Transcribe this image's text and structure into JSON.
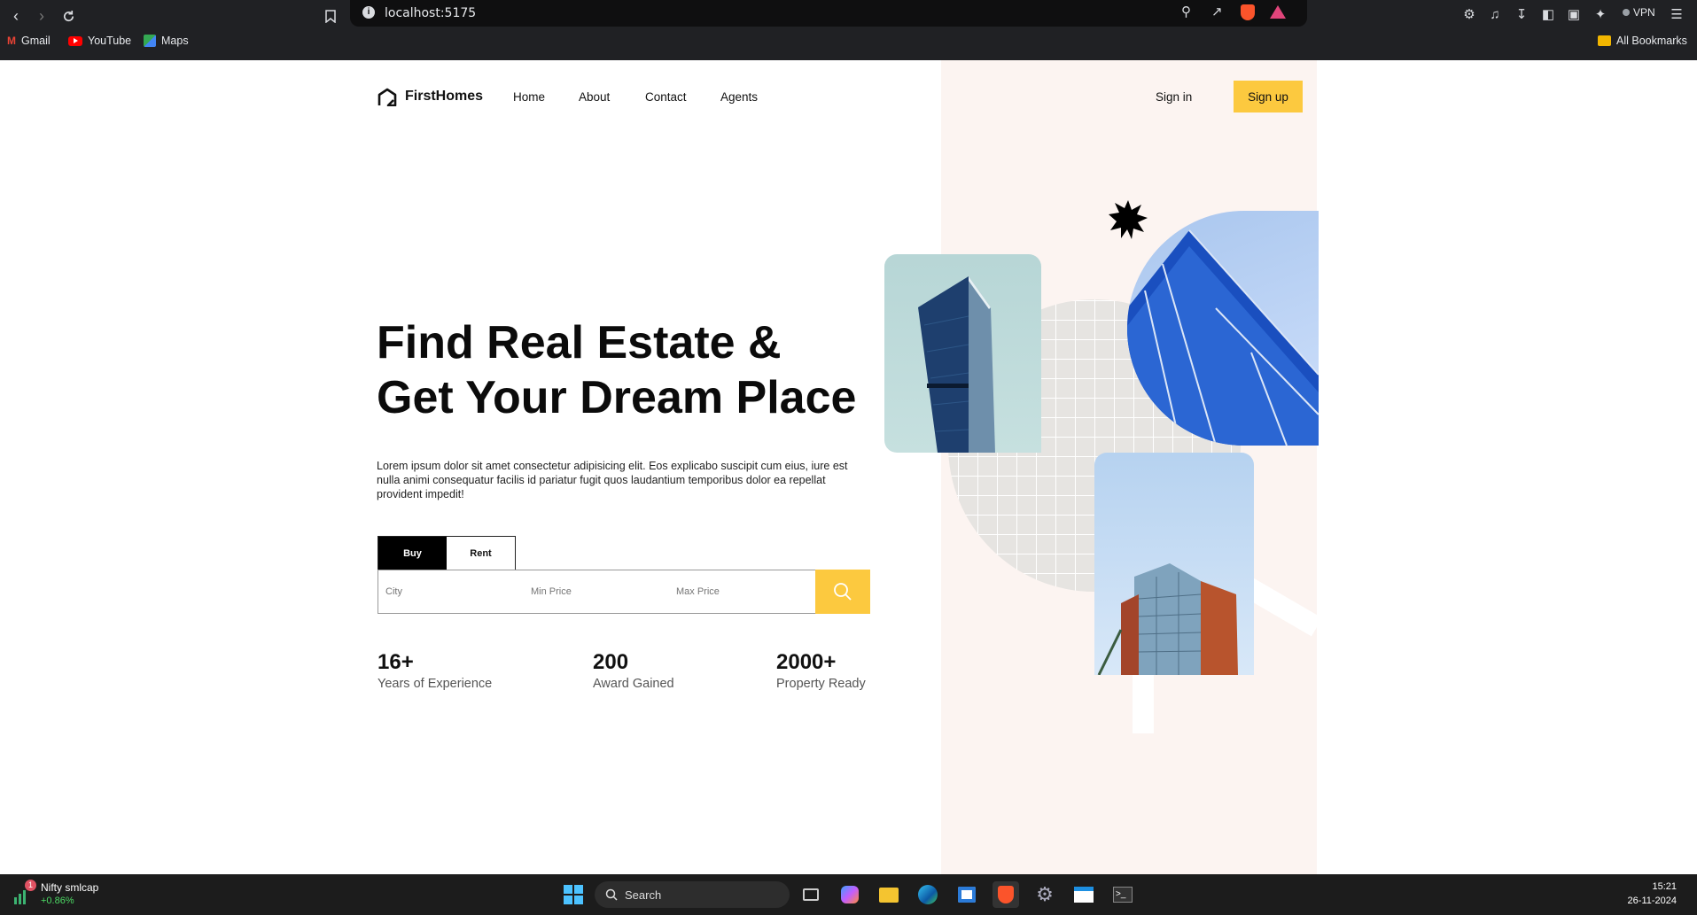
{
  "browser": {
    "url": "localhost:5175",
    "bookmarks": [
      {
        "label": "Gmail",
        "icon": "gmail-icon"
      },
      {
        "label": "YouTube",
        "icon": "youtube-icon"
      },
      {
        "label": "Maps",
        "icon": "maps-icon"
      }
    ],
    "all_bookmarks": "All Bookmarks",
    "vpn_label": "VPN"
  },
  "site": {
    "brand": "FirstHomes",
    "nav": [
      {
        "label": "Home"
      },
      {
        "label": "About"
      },
      {
        "label": "Contact"
      },
      {
        "label": "Agents"
      }
    ],
    "sign_in": "Sign in",
    "sign_up": "Sign up",
    "accent": "#fcc93f"
  },
  "hero": {
    "headline_line1": "Find Real Estate &",
    "headline_line2": "Get Your Dream Place",
    "description": "Lorem ipsum dolor sit amet consectetur adipisicing elit. Eos explicabo suscipit cum eius, iure est nulla animi consequatur facilis id pariatur fugit quos laudantium temporibus dolor ea repellat provident impedit!"
  },
  "search": {
    "tabs": [
      {
        "label": "Buy",
        "active": true
      },
      {
        "label": "Rent",
        "active": false
      }
    ],
    "city_placeholder": "City",
    "min_price_placeholder": "Min Price",
    "max_price_placeholder": "Max Price"
  },
  "stats": [
    {
      "value": "16+",
      "label": "Years of Experience"
    },
    {
      "value": "200",
      "label": "Award Gained"
    },
    {
      "value": "2000+",
      "label": "Property Ready"
    }
  ],
  "taskbar": {
    "widget_title": "Nifty smlcap",
    "widget_value": "+0.86%",
    "widget_badge": "1",
    "search_label": "Search",
    "time": "15:21",
    "date": "26-11-2024"
  }
}
